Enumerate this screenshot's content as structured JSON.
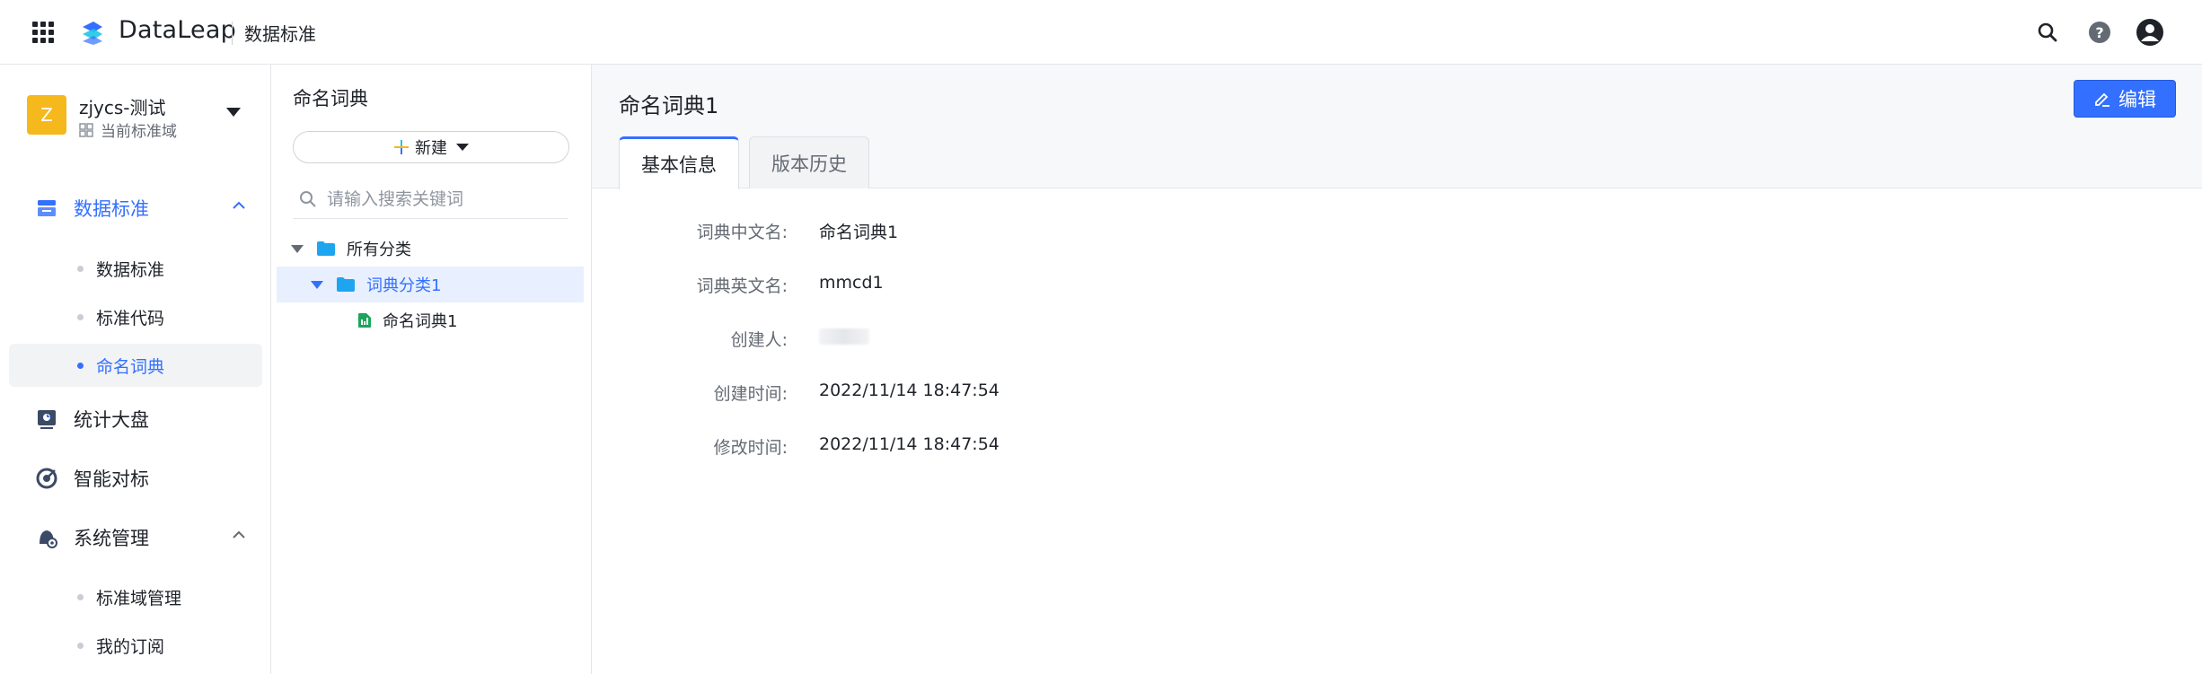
{
  "topbar": {
    "brand": "DataLeap",
    "product": "数据标准",
    "icons": [
      "apps-grid-icon",
      "dataleap-logo-icon",
      "search-icon",
      "help-icon",
      "user-avatar-icon"
    ]
  },
  "workspace": {
    "initial": "Z",
    "name": "zjycs-测试",
    "subtitle": "当前标准域"
  },
  "nav": {
    "groups": [
      {
        "label": "数据标准",
        "icon": "data-standard-icon",
        "expanded": true,
        "active": true
      },
      {
        "label": "统计大盘",
        "icon": "dashboard-icon"
      },
      {
        "label": "智能对标",
        "icon": "target-icon"
      },
      {
        "label": "系统管理",
        "icon": "system-manage-icon",
        "expanded": true
      }
    ],
    "standard_items": [
      {
        "label": "数据标准"
      },
      {
        "label": "标准代码"
      },
      {
        "label": "命名词典",
        "active": true
      }
    ],
    "system_items": [
      {
        "label": "标准域管理"
      },
      {
        "label": "我的订阅"
      }
    ]
  },
  "tree": {
    "title": "命名词典",
    "new_label": "新建",
    "search_placeholder": "请输入搜索关键词",
    "nodes": [
      {
        "label": "所有分类",
        "type": "folder",
        "level": 0
      },
      {
        "label": "词典分类1",
        "type": "folder",
        "level": 1,
        "selected": true
      },
      {
        "label": "命名词典1",
        "type": "file",
        "level": 2
      }
    ]
  },
  "detail": {
    "title": "命名词典1",
    "edit_label": "编辑",
    "tabs": [
      {
        "label": "基本信息",
        "active": true
      },
      {
        "label": "版本历史"
      }
    ],
    "fields": [
      {
        "label": "词典中文名:",
        "value": "命名词典1"
      },
      {
        "label": "词典英文名:",
        "value": "mmcd1"
      },
      {
        "label": "创建人:",
        "value": ""
      },
      {
        "label": "创建时间:",
        "value": "2022/11/14 18:47:54"
      },
      {
        "label": "修改时间:",
        "value": "2022/11/14 18:47:54"
      }
    ]
  },
  "colors": {
    "accent": "#3370ff",
    "workspace_avatar": "#f5b81d",
    "selected_row_bg": "#e8f0ff",
    "active_nav_bg": "#f2f3f5"
  }
}
